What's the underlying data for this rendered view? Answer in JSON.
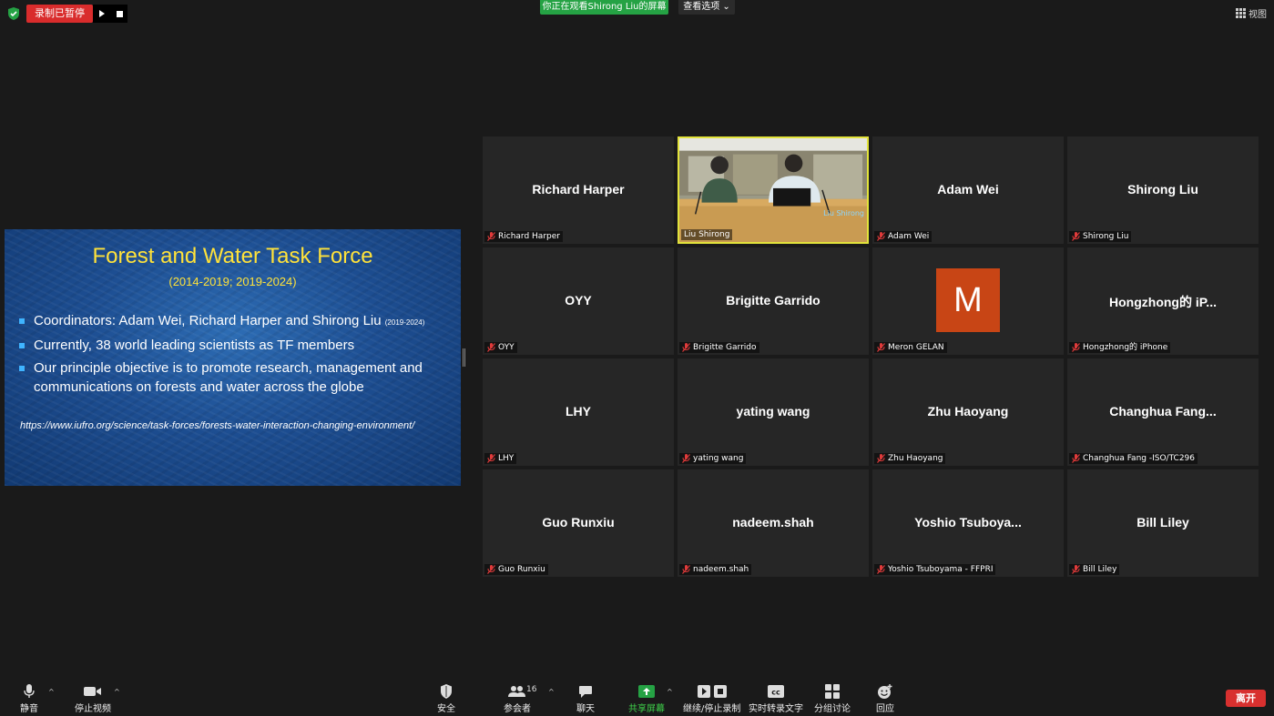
{
  "top_bar": {
    "recording_status": "录制已暂停",
    "viewing_banner": "你正在观看Shirong Liu的屏幕",
    "view_options_label": "查看选项 ⌄",
    "view_toggle_label": "视图"
  },
  "shared_screen": {
    "title": "Forest and Water Task Force",
    "subtitle": "(2014-2019; 2019-2024)",
    "bullets": [
      {
        "text": "Coordinators: Adam Wei, Richard Harper and Shirong Liu",
        "note": "(2019-2024)"
      },
      {
        "text": "Currently, 38 world leading scientists as TF members",
        "note": ""
      },
      {
        "text": "Our principle objective is to promote research, management and communications on forests and water across the globe",
        "note": ""
      }
    ],
    "link": "https://www.iufro.org/science/task-forces/forests-water-interaction-changing-environment/"
  },
  "participants": [
    {
      "display": "Richard Harper",
      "label": "Richard Harper"
    },
    {
      "display": "",
      "label": "Liu Shirong",
      "video": true,
      "video_watermark": "Liu Shirong"
    },
    {
      "display": "Adam Wei",
      "label": "Adam Wei"
    },
    {
      "display": "Shirong Liu",
      "label": "Shirong Liu"
    },
    {
      "display": "OYY",
      "label": "OYY"
    },
    {
      "display": "Brigitte Garrido",
      "label": "Brigitte Garrido"
    },
    {
      "display": "",
      "label": "Meron GELAN",
      "avatar_letter": "M",
      "avatar_color": "#c84515"
    },
    {
      "display": "Hongzhong的 iP...",
      "label": "Hongzhong的 iPhone"
    },
    {
      "display": "LHY",
      "label": "LHY"
    },
    {
      "display": "yating wang",
      "label": "yating wang"
    },
    {
      "display": "Zhu Haoyang",
      "label": "Zhu Haoyang"
    },
    {
      "display": "Changhua  Fang...",
      "label": "Changhua Fang -ISO/TC296"
    },
    {
      "display": "Guo Runxiu",
      "label": "Guo Runxiu"
    },
    {
      "display": "nadeem.shah",
      "label": "nadeem.shah"
    },
    {
      "display": "Yoshio  Tsuboya...",
      "label": "Yoshio Tsuboyama - FFPRI"
    },
    {
      "display": "Bill Liley",
      "label": "Bill Liley"
    }
  ],
  "toolbar": {
    "mute": "静音",
    "stop_video": "停止视频",
    "security": "安全",
    "participants": "参会者",
    "participant_count": "16",
    "chat": "聊天",
    "share_screen": "共享屏幕",
    "recording": "继续/停止录制",
    "live_transcript": "实时转录文字",
    "breakout": "分组讨论",
    "reactions": "回应",
    "leave": "离开"
  },
  "colors": {
    "recording_red": "#d92c2c",
    "viewing_green": "#25a244",
    "active_speaker_border": "#e2e33b",
    "leave_red": "#d8302f",
    "slide_title_yellow": "#ffe23a"
  }
}
